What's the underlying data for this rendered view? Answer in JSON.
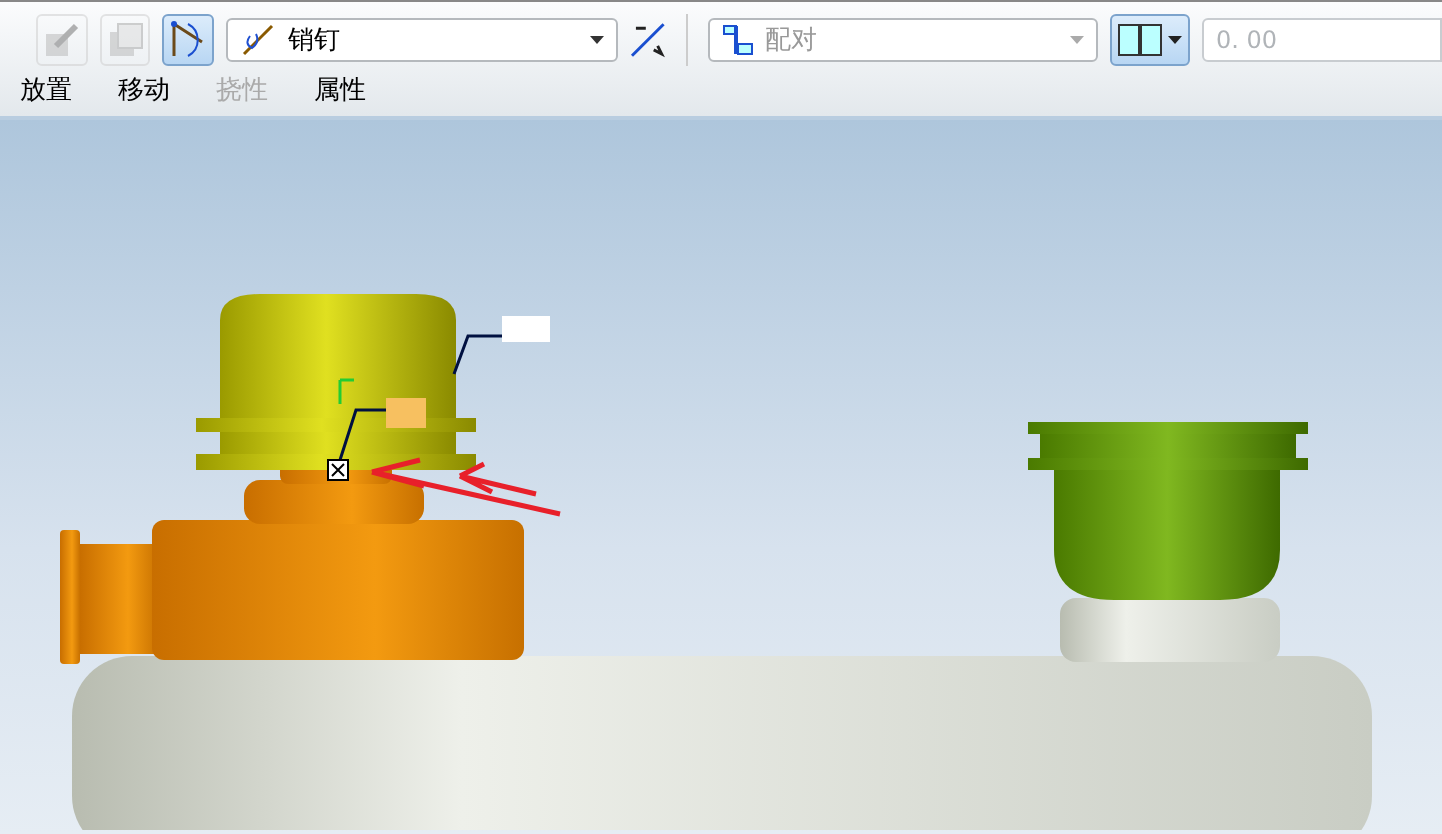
{
  "toolbar": {
    "tools": [
      {
        "kind": "edit",
        "disabled": true,
        "selected": false
      },
      {
        "kind": "square",
        "disabled": true,
        "selected": false
      },
      {
        "kind": "arc",
        "disabled": false,
        "selected": true
      }
    ],
    "connection_type": {
      "value": "销钉"
    },
    "constraint_type": {
      "value": "配对",
      "disabled": true
    },
    "offset": {
      "placeholder": "0. 00",
      "disabled": true
    }
  },
  "tabs": [
    {
      "label": "放置",
      "disabled": false
    },
    {
      "label": "移动",
      "disabled": false
    },
    {
      "label": "挠性",
      "disabled": true
    },
    {
      "label": "属性",
      "disabled": false
    }
  ]
}
